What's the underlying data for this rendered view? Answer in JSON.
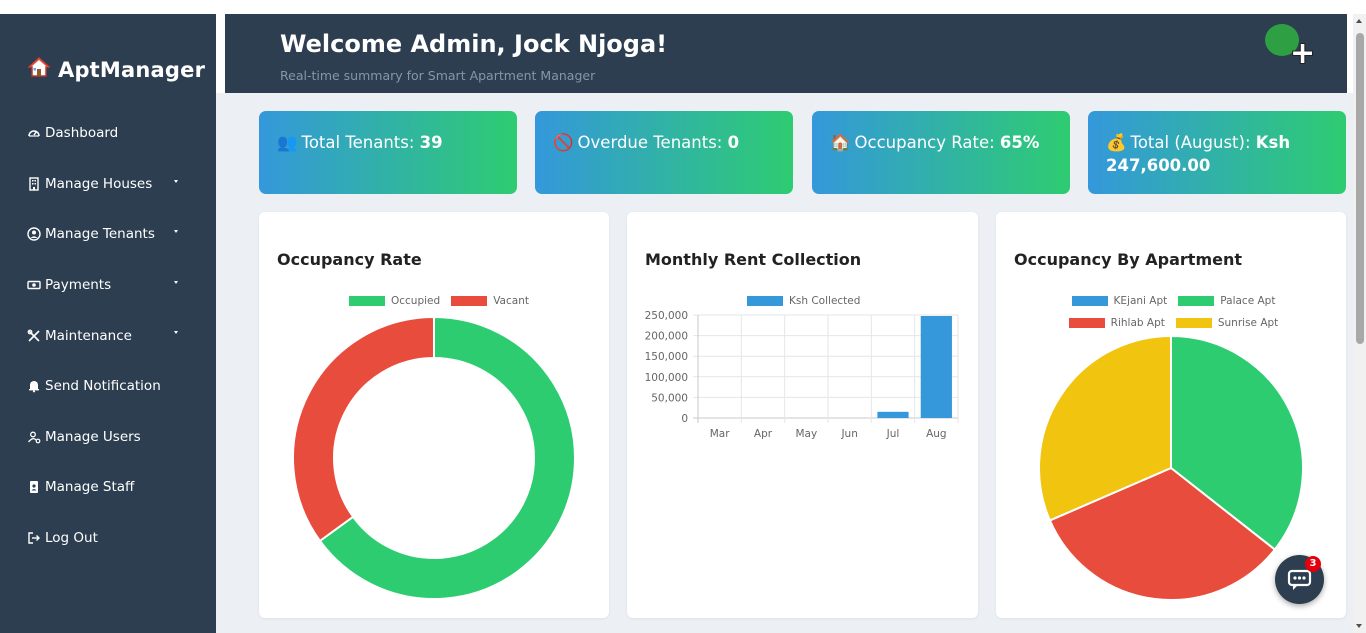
{
  "brand": {
    "name": "AptManager",
    "icon": "house-icon"
  },
  "sidebar": {
    "items": [
      {
        "label": "Dashboard",
        "icon": "dashboard-gauge-icon",
        "dropdown": false
      },
      {
        "label": "Manage Houses",
        "icon": "building-icon",
        "dropdown": true
      },
      {
        "label": "Manage Tenants",
        "icon": "user-circle-icon",
        "dropdown": true
      },
      {
        "label": "Payments",
        "icon": "money-bill-icon",
        "dropdown": true
      },
      {
        "label": "Maintenance",
        "icon": "tools-icon",
        "dropdown": true
      },
      {
        "label": "Send Notification",
        "icon": "bell-icon",
        "dropdown": false
      },
      {
        "label": "Manage Users",
        "icon": "user-gear-icon",
        "dropdown": false
      },
      {
        "label": "Manage Staff",
        "icon": "id-badge-icon",
        "dropdown": false
      },
      {
        "label": "Log Out",
        "icon": "sign-out-icon",
        "dropdown": false
      }
    ]
  },
  "header": {
    "title": "Welcome Admin, Jock Njoga!",
    "subtitle": "Real-time summary for Smart Apartment Manager"
  },
  "stats": [
    {
      "emoji": "👥",
      "label": "Total Tenants:",
      "value": "39"
    },
    {
      "emoji": "🚫",
      "label": "Overdue Tenants:",
      "value": "0"
    },
    {
      "emoji": "🏠",
      "label": "Occupancy Rate:",
      "value": "65%"
    },
    {
      "emoji": "💰",
      "label": "Total (August):",
      "value": "Ksh 247,600.00"
    }
  ],
  "colors": {
    "sidebar_bg": "#2c3e50",
    "green": "#2ecc71",
    "red": "#e74c3c",
    "blue": "#3498db",
    "yellow": "#f1c40f",
    "badge_red": "#e3000f"
  },
  "chat": {
    "badge_count": "3",
    "icon": "chat-bubble-icon"
  },
  "chart_data": [
    {
      "type": "doughnut",
      "title": "Occupancy Rate",
      "labels": [
        "Occupied",
        "Vacant"
      ],
      "values": [
        65,
        35
      ],
      "colors": [
        "#2ecc71",
        "#e74c3c"
      ],
      "legend": "top"
    },
    {
      "type": "bar",
      "title": "Monthly Rent Collection",
      "categories": [
        "Mar",
        "Apr",
        "May",
        "Jun",
        "Jul",
        "Aug"
      ],
      "series": [
        {
          "name": "Ksh Collected",
          "values": [
            0,
            0,
            0,
            0,
            15000,
            247600
          ],
          "color": "#3498db"
        }
      ],
      "yticks": [
        "0",
        "50,000",
        "100,000",
        "150,000",
        "200,000",
        "250,000"
      ],
      "ylim": [
        0,
        250000
      ],
      "grid": true,
      "legend": "top"
    },
    {
      "type": "pie",
      "title": "Occupancy By Apartment",
      "labels": [
        "KEjani Apt",
        "Palace Apt",
        "Rihlab Apt",
        "Sunrise Apt"
      ],
      "values": [
        0,
        35.6,
        32.9,
        31.5
      ],
      "colors": [
        "#3498db",
        "#2ecc71",
        "#e74c3c",
        "#f1c40f"
      ],
      "legend": "top"
    }
  ]
}
